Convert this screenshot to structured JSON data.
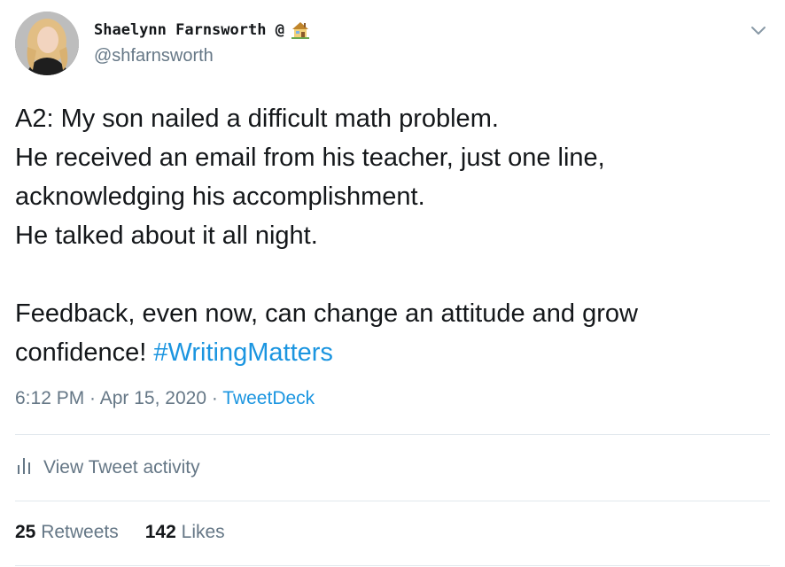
{
  "author": {
    "display_name": "Shaelynn Farnsworth @",
    "emoji_icon": "house-icon",
    "handle": "@shfarnsworth",
    "avatar_icon": "avatar"
  },
  "menu": {
    "icon": "chevron-down-icon"
  },
  "tweet": {
    "lines": [
      "A2: My son nailed a difficult math problem.",
      "He received an email from his teacher, just one line,",
      "acknowledging his accomplishment.",
      "He talked about it all night."
    ],
    "line5": "Feedback, even now, can change an attitude and grow",
    "line6_text": "confidence! ",
    "hashtag": "#WritingMatters"
  },
  "meta": {
    "time": "6:12 PM",
    "sep1": " · ",
    "date": "Apr 15, 2020",
    "sep2": " · ",
    "source": "TweetDeck"
  },
  "activity": {
    "label": "View Tweet activity",
    "icon": "bar-chart-icon"
  },
  "stats": {
    "retweets_count": "25",
    "retweets_label": "Retweets",
    "likes_count": "142",
    "likes_label": "Likes"
  },
  "colors": {
    "link": "#1b95e0",
    "secondary": "#657786",
    "text": "#14171a",
    "divider": "#e1e8ed"
  }
}
